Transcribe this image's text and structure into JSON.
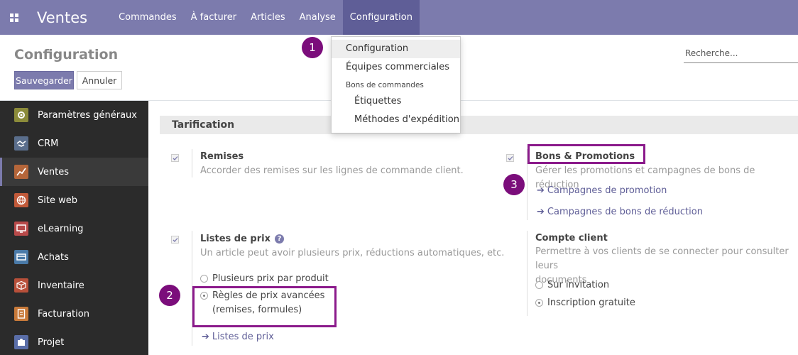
{
  "navbar": {
    "app_name": "Ventes",
    "menu": [
      "Commandes",
      "À facturer",
      "Articles",
      "Analyse",
      "Configuration"
    ],
    "active_menu": "Configuration",
    "color": "#7c7bad"
  },
  "control_panel": {
    "title": "Configuration",
    "save_label": "Sauvegarder",
    "cancel_label": "Annuler",
    "search_placeholder": "Recherche..."
  },
  "dropdown": {
    "items": [
      {
        "label": "Configuration",
        "highlighted": true
      },
      {
        "label": "Équipes commerciales"
      }
    ],
    "group_header": "Bons de commandes",
    "sub_items": [
      "Étiquettes",
      "Méthodes d'expédition"
    ]
  },
  "sidebar": {
    "items": [
      {
        "label": "Paramètres généraux",
        "icon": "gear-icon",
        "color": "#8b8b3a"
      },
      {
        "label": "CRM",
        "icon": "handshake-icon",
        "color": "#5a6e8c"
      },
      {
        "label": "Ventes",
        "icon": "chart-icon",
        "color": "#b5663a",
        "active": true
      },
      {
        "label": "Site web",
        "icon": "globe-icon",
        "color": "#c25a3a"
      },
      {
        "label": "eLearning",
        "icon": "elearning-icon",
        "color": "#b84a4a"
      },
      {
        "label": "Achats",
        "icon": "card-icon",
        "color": "#4a7aa8"
      },
      {
        "label": "Inventaire",
        "icon": "box-icon",
        "color": "#b8503a"
      },
      {
        "label": "Facturation",
        "icon": "invoice-icon",
        "color": "#c87a3a"
      },
      {
        "label": "Projet",
        "icon": "puzzle-icon",
        "color": "#5a6ea8"
      }
    ]
  },
  "settings": {
    "section_title": "Tarification",
    "discounts": {
      "title": "Remises",
      "description": "Accorder des remises sur les lignes de commande client."
    },
    "coupons": {
      "title": "Bons & Promotions",
      "description": "Gérer les promotions et campagnes de bons de réduction",
      "link1": "Campagnes de promotion",
      "link2": "Campagnes de bons de réduction"
    },
    "pricelists": {
      "title": "Listes de prix",
      "help": "?",
      "description": "Un article peut avoir plusieurs prix, réductions automatiques, etc.",
      "option1": "Plusieurs prix par produit",
      "option2_line1": "Règles de prix avancées",
      "option2_line2": "(remises, formules)",
      "selected": "option2",
      "link": "Listes de prix"
    },
    "customer_account": {
      "title": "Compte client",
      "description_line1": "Permettre à vos clients de se connecter pour consulter leurs",
      "description_line2": "documents",
      "option1": "Sur invitation",
      "option2": "Inscription gratuite",
      "selected": "option2"
    }
  },
  "annotations": {
    "badges": [
      "1",
      "2",
      "3"
    ],
    "color": "#8b1a8b"
  }
}
